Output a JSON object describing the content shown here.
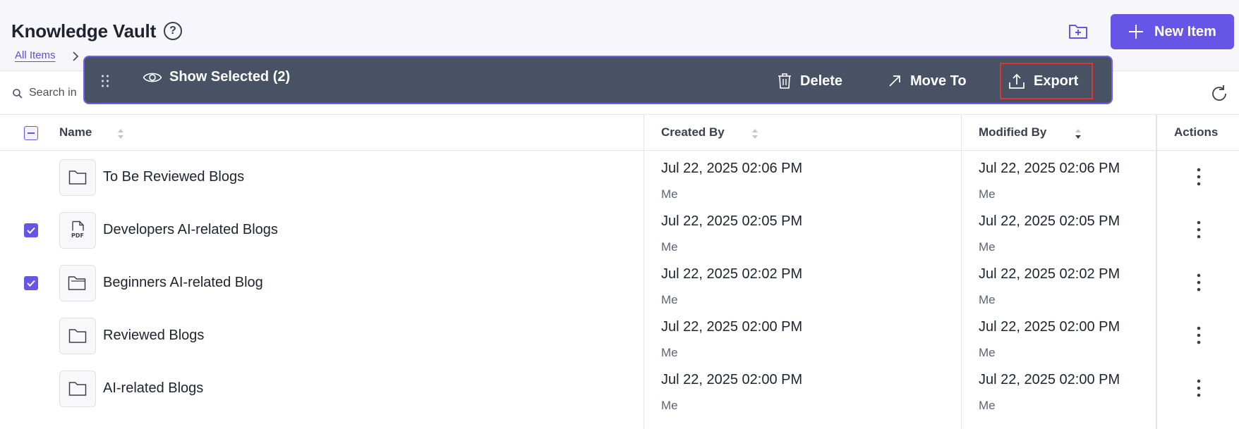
{
  "header": {
    "title": "Knowledge Vault",
    "help_icon": "?",
    "breadcrumb": "All Items",
    "new_item_label": "New Item"
  },
  "search": {
    "placeholder": "Search in"
  },
  "toolbar": {
    "show_selected_label": "Show Selected (2)",
    "delete_label": "Delete",
    "move_label": "Move To",
    "export_label": "Export"
  },
  "table": {
    "columns": {
      "name": "Name",
      "created": "Created By",
      "modified": "Modified By",
      "actions": "Actions"
    },
    "rows": [
      {
        "name": "To Be Reviewed Blogs",
        "icon": "folder-icon",
        "checked": false,
        "created_date": "Jul 22, 2025 02:06 PM",
        "created_by": "Me",
        "modified_date": "Jul 22, 2025 02:06 PM",
        "modified_by": "Me"
      },
      {
        "name": "Developers AI-related Blogs",
        "icon": "pdf-file-icon",
        "checked": true,
        "created_date": "Jul 22, 2025 02:05 PM",
        "created_by": "Me",
        "modified_date": "Jul 22, 2025 02:05 PM",
        "modified_by": "Me"
      },
      {
        "name": "Beginners AI-related Blog",
        "icon": "folder-open-icon",
        "checked": true,
        "created_date": "Jul 22, 2025 02:02 PM",
        "created_by": "Me",
        "modified_date": "Jul 22, 2025 02:02 PM",
        "modified_by": "Me"
      },
      {
        "name": "Reviewed Blogs",
        "icon": "folder-icon",
        "checked": false,
        "created_date": "Jul 22, 2025 02:00 PM",
        "created_by": "Me",
        "modified_date": "Jul 22, 2025 02:00 PM",
        "modified_by": "Me"
      },
      {
        "name": "AI-related Blogs",
        "icon": "folder-icon",
        "checked": false,
        "created_date": "Jul 22, 2025 02:00 PM",
        "created_by": "Me",
        "modified_date": "Jul 22, 2025 02:00 PM",
        "modified_by": "Me"
      }
    ]
  },
  "colors": {
    "accent": "#6655e6",
    "toolbar_bg": "#485264",
    "export_highlight": "#e0362b"
  }
}
